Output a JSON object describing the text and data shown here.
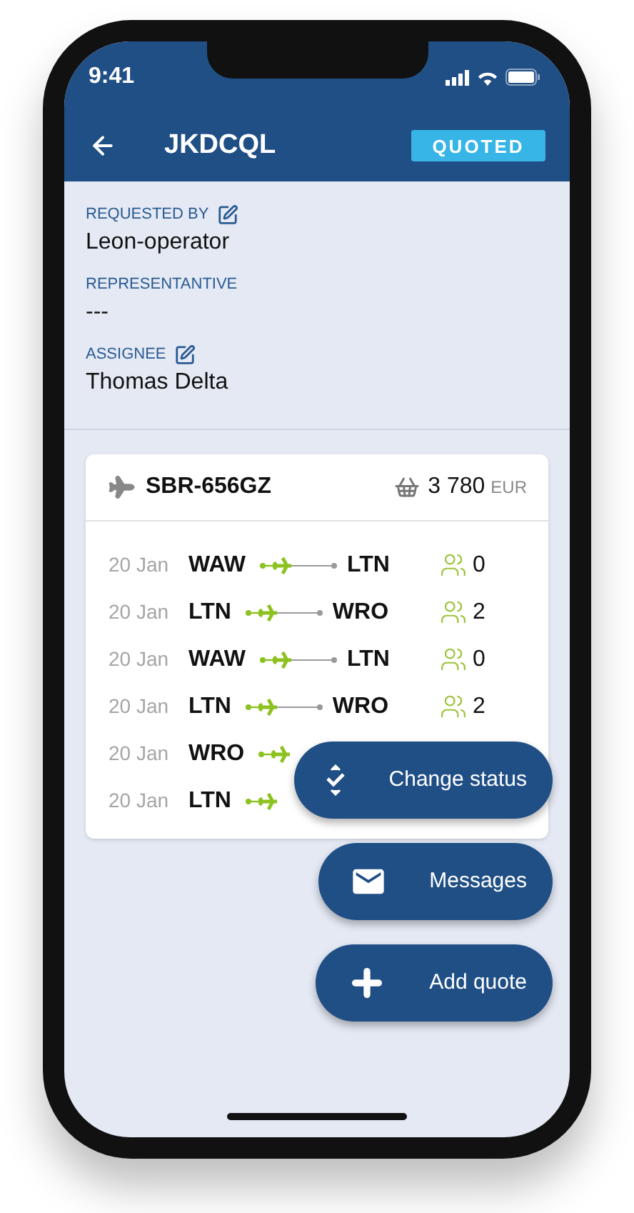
{
  "status_bar": {
    "time": "9:41"
  },
  "header": {
    "title": "JKDCQL",
    "status": "QUOTED"
  },
  "fields": [
    {
      "label": "REQUESTED BY",
      "value": "Leon-operator",
      "editable": true
    },
    {
      "label": "REPRESENTANTIVE",
      "value": "---",
      "editable": false
    },
    {
      "label": "ASSIGNEE",
      "value": "Thomas Delta",
      "editable": true
    }
  ],
  "flight": {
    "registration": "SBR-656GZ",
    "price": "3 780",
    "currency": "EUR",
    "legs": [
      {
        "date": "20 Jan",
        "from": "WAW",
        "to": "LTN",
        "pax": "0"
      },
      {
        "date": "20 Jan",
        "from": "LTN",
        "to": "WRO",
        "pax": "2"
      },
      {
        "date": "20 Jan",
        "from": "WAW",
        "to": "LTN",
        "pax": "0"
      },
      {
        "date": "20 Jan",
        "from": "LTN",
        "to": "WRO",
        "pax": "2"
      },
      {
        "date": "20 Jan",
        "from": "WRO"
      },
      {
        "date": "20 Jan",
        "from": "LTN"
      }
    ]
  },
  "actions": [
    {
      "label": "Change status",
      "kind": "status"
    },
    {
      "label": "Messages",
      "kind": "messages"
    },
    {
      "label": "Add quote",
      "kind": "add"
    }
  ]
}
